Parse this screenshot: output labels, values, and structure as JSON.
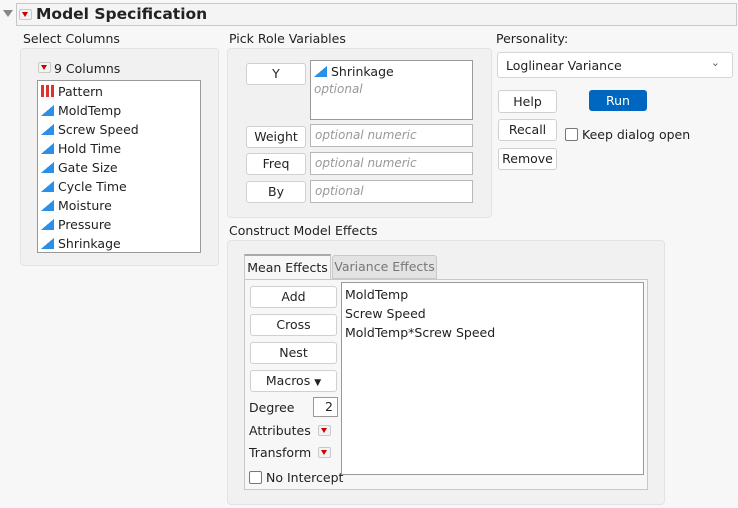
{
  "title": "Model Specification",
  "select_columns": {
    "label": "Select Columns",
    "count_label": "9 Columns",
    "columns": [
      {
        "name": "Pattern",
        "type": "nominal"
      },
      {
        "name": "MoldTemp",
        "type": "continuous"
      },
      {
        "name": "Screw Speed",
        "type": "continuous"
      },
      {
        "name": "Hold Time",
        "type": "continuous"
      },
      {
        "name": "Gate Size",
        "type": "continuous"
      },
      {
        "name": "Cycle Time",
        "type": "continuous"
      },
      {
        "name": "Moisture",
        "type": "continuous"
      },
      {
        "name": "Pressure",
        "type": "continuous"
      },
      {
        "name": "Shrinkage",
        "type": "continuous"
      }
    ]
  },
  "roles": {
    "label": "Pick Role Variables",
    "y": {
      "button": "Y",
      "value": "Shrinkage",
      "placeholder": "optional"
    },
    "weight": {
      "button": "Weight",
      "placeholder": "optional numeric"
    },
    "freq": {
      "button": "Freq",
      "placeholder": "optional numeric"
    },
    "by": {
      "button": "By",
      "placeholder": "optional"
    }
  },
  "personality": {
    "label": "Personality:",
    "value": "Loglinear Variance"
  },
  "actions": {
    "help": "Help",
    "run": "Run",
    "recall": "Recall",
    "remove": "Remove",
    "keep_open": "Keep dialog open",
    "keep_open_checked": false
  },
  "effects": {
    "label": "Construct Model Effects",
    "tabs": [
      {
        "label": "Mean Effects",
        "active": true
      },
      {
        "label": "Variance Effects",
        "active": false
      }
    ],
    "add": "Add",
    "cross": "Cross",
    "nest": "Nest",
    "macros": "Macros",
    "degree_label": "Degree",
    "degree": "2",
    "attributes": "Attributes",
    "transform": "Transform",
    "no_intercept": "No Intercept",
    "no_intercept_checked": false,
    "items": [
      "MoldTemp",
      "Screw Speed",
      "MoldTemp*Screw Speed"
    ]
  },
  "colors": {
    "accent": "#0067c0",
    "red": "#cc0000",
    "continuous": "#2a8fe6"
  }
}
